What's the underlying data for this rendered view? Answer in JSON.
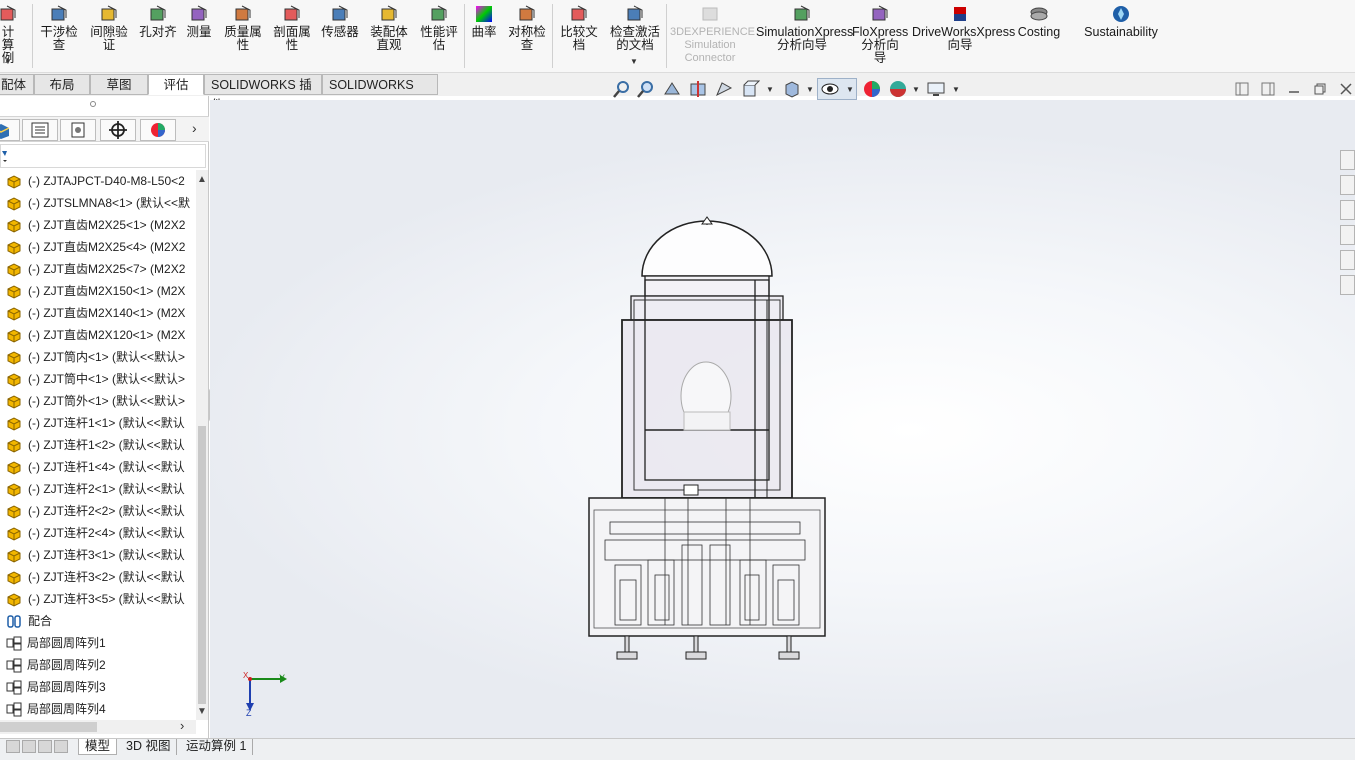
{
  "ribbon": {
    "buttons": [
      {
        "id": "design-study",
        "label": "计算\n例",
        "icon": "calc-icon"
      },
      {
        "id": "interference",
        "label": "干涉检\n查",
        "icon": "interference-icon"
      },
      {
        "id": "clearance",
        "label": "间隙验\n证",
        "icon": "clearance-icon"
      },
      {
        "id": "hole-align",
        "label": "孔对齐",
        "icon": "hole-align-icon"
      },
      {
        "id": "measure",
        "label": "测量",
        "icon": "measure-icon"
      },
      {
        "id": "mass-props",
        "label": "质量属\n性",
        "icon": "mass-icon"
      },
      {
        "id": "section-props",
        "label": "剖面属\n性",
        "icon": "section-icon"
      },
      {
        "id": "sensor",
        "label": "传感器",
        "icon": "sensor-icon"
      },
      {
        "id": "assembly-visual",
        "label": "装配体\n直观",
        "icon": "assembly-visual-icon"
      },
      {
        "id": "performance",
        "label": "性能评\n估",
        "icon": "performance-icon"
      },
      {
        "id": "curvature",
        "label": "曲率",
        "icon": "curvature-icon"
      },
      {
        "id": "symmetry",
        "label": "对称检\n查",
        "icon": "symmetry-icon"
      },
      {
        "id": "compare",
        "label": "比较文\n档",
        "icon": "compare-icon"
      },
      {
        "id": "check-active",
        "label": "检查激活\n的文档",
        "icon": "check-doc-icon"
      },
      {
        "id": "3dx",
        "label": "3DEXPERIENCE\nSimulation\nConnector",
        "icon": "3dx-icon"
      },
      {
        "id": "simxpress",
        "label": "SimulationXpress\n分析向导",
        "icon": "simxpress-icon"
      },
      {
        "id": "floxpress",
        "label": "FloXpress\n分析向\n导",
        "icon": "floxpress-icon"
      },
      {
        "id": "driveworks",
        "label": "DriveWorksXpress\n向导",
        "icon": "driveworks-icon"
      },
      {
        "id": "costing",
        "label": "Costing",
        "icon": "costing-icon"
      },
      {
        "id": "sustainability",
        "label": "Sustainability",
        "icon": "sustainability-icon"
      }
    ]
  },
  "tabs": [
    "配体",
    "布局",
    "草图",
    "评估",
    "SOLIDWORKS 插件",
    "SOLIDWORKS MBD"
  ],
  "active_tab": "评估",
  "tree": {
    "items": [
      {
        "label": "(-) ZJTAJPCT-D40-M8-L50<2",
        "icon": "part-icon"
      },
      {
        "label": "(-) ZJTSLMNA8<1> (默认<<默",
        "icon": "part-icon"
      },
      {
        "label": "(-) ZJT直齿M2X25<1> (M2X2",
        "icon": "part-icon"
      },
      {
        "label": "(-) ZJT直齿M2X25<4> (M2X2",
        "icon": "part-icon"
      },
      {
        "label": "(-) ZJT直齿M2X25<7> (M2X2",
        "icon": "part-icon"
      },
      {
        "label": "(-) ZJT直齿M2X150<1> (M2X",
        "icon": "part-icon"
      },
      {
        "label": "(-) ZJT直齿M2X140<1> (M2X",
        "icon": "part-icon"
      },
      {
        "label": "(-) ZJT直齿M2X120<1> (M2X",
        "icon": "part-icon"
      },
      {
        "label": "(-) ZJT筒内<1> (默认<<默认>",
        "icon": "part-icon"
      },
      {
        "label": "(-) ZJT筒中<1> (默认<<默认>",
        "icon": "part-icon"
      },
      {
        "label": "(-) ZJT筒外<1> (默认<<默认>",
        "icon": "part-icon"
      },
      {
        "label": "(-) ZJT连杆1<1> (默认<<默认",
        "icon": "part-icon"
      },
      {
        "label": "(-) ZJT连杆1<2> (默认<<默认",
        "icon": "part-icon"
      },
      {
        "label": "(-) ZJT连杆1<4> (默认<<默认",
        "icon": "part-icon"
      },
      {
        "label": "(-) ZJT连杆2<1> (默认<<默认",
        "icon": "part-icon"
      },
      {
        "label": "(-) ZJT连杆2<2> (默认<<默认",
        "icon": "part-icon"
      },
      {
        "label": "(-) ZJT连杆2<4> (默认<<默认",
        "icon": "part-icon"
      },
      {
        "label": "(-) ZJT连杆3<1> (默认<<默认",
        "icon": "part-icon"
      },
      {
        "label": "(-) ZJT连杆3<2> (默认<<默认",
        "icon": "part-icon"
      },
      {
        "label": "(-) ZJT连杆3<5> (默认<<默认",
        "icon": "part-icon"
      },
      {
        "label": "配合",
        "icon": "mates-icon"
      },
      {
        "label": "局部圆周阵列1",
        "icon": "pattern-icon"
      },
      {
        "label": "局部圆周阵列2",
        "icon": "pattern-icon"
      },
      {
        "label": "局部圆周阵列3",
        "icon": "pattern-icon"
      },
      {
        "label": "局部圆周阵列4",
        "icon": "pattern-icon"
      }
    ]
  },
  "bottom_tabs": [
    "模型",
    "3D 视图",
    "运动算例 1"
  ],
  "active_bottom_tab": "模型",
  "triad": {
    "y_label": "Y",
    "z_label": "Z",
    "x_label": "X"
  },
  "colors": {
    "accent": "#1f5fa8",
    "part_yellow": "#e0a800",
    "tab_border": "#b8b8b8"
  }
}
